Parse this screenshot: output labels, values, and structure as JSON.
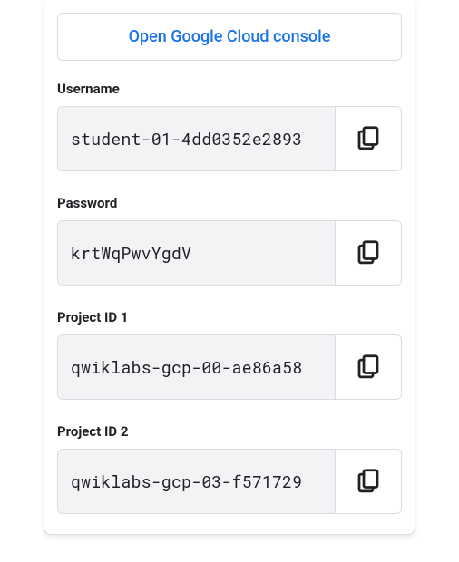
{
  "open_console_label": "Open Google Cloud console",
  "fields": [
    {
      "label": "Username",
      "value": "student-01-4dd0352e2893"
    },
    {
      "label": "Password",
      "value": "krtWqPwvYgdV"
    },
    {
      "label": "Project ID 1",
      "value": "qwiklabs-gcp-00-ae86a58"
    },
    {
      "label": "Project ID 2",
      "value": "qwiklabs-gcp-03-f571729"
    }
  ]
}
